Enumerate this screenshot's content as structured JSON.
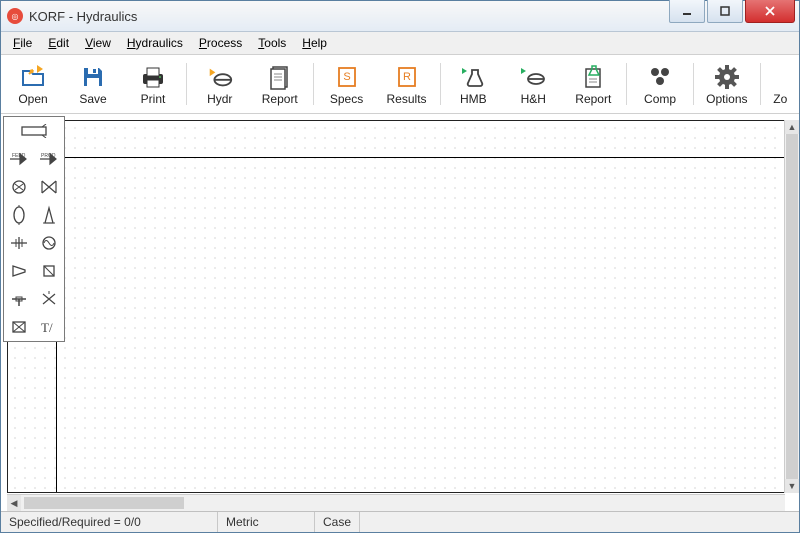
{
  "title": "KORF - Hydraulics",
  "menu": {
    "file": "File",
    "edit": "Edit",
    "view": "View",
    "hydraulics": "Hydraulics",
    "process": "Process",
    "tools": "Tools",
    "help": "Help"
  },
  "toolbar": {
    "open": "Open",
    "save": "Save",
    "print": "Print",
    "hydr": "Hydr",
    "report1": "Report",
    "specs": "Specs",
    "results": "Results",
    "hmb": "HMB",
    "hh": "H&H",
    "report2": "Report",
    "comp": "Comp",
    "options": "Options",
    "zoom": "Zo"
  },
  "status": {
    "spec": "Specified/Required = 0/0",
    "units": "Metric",
    "case": "Case"
  }
}
